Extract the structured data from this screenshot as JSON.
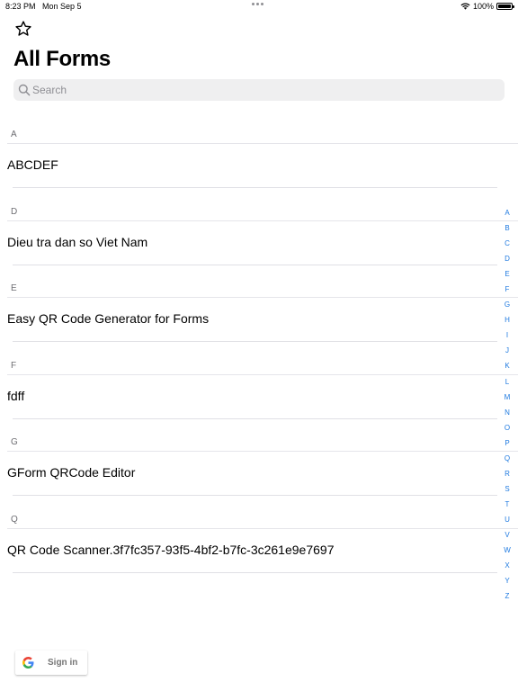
{
  "status_bar": {
    "time": "8:23 PM",
    "date": "Mon Sep 5",
    "battery": "100%",
    "battery_level": 1.0
  },
  "header": {
    "title": "All Forms",
    "favorite_icon": "star-outline-icon"
  },
  "search": {
    "placeholder": "Search",
    "value": "",
    "icon": "magnifying-glass-icon"
  },
  "sections": [
    {
      "letter": "A",
      "items": [
        "ABCDEF"
      ]
    },
    {
      "letter": "D",
      "items": [
        "Dieu tra dan so Viet Nam"
      ]
    },
    {
      "letter": "E",
      "items": [
        "Easy QR Code Generator for Forms"
      ]
    },
    {
      "letter": "F",
      "items": [
        "fdff"
      ]
    },
    {
      "letter": "G",
      "items": [
        "GForm QRCode Editor"
      ]
    },
    {
      "letter": "Q",
      "items": [
        "QR Code Scanner.3f7fc357-93f5-4bf2-b7fc-3c261e9e7697"
      ]
    }
  ],
  "index_bar": [
    "A",
    "B",
    "C",
    "D",
    "E",
    "F",
    "G",
    "H",
    "I",
    "J",
    "K",
    "L",
    "M",
    "N",
    "O",
    "P",
    "Q",
    "R",
    "S",
    "T",
    "U",
    "V",
    "W",
    "X",
    "Y",
    "Z"
  ],
  "signin": {
    "label": "Sign in",
    "icon": "google-g-icon"
  },
  "colors": {
    "accent": "#1f7ae0",
    "section_header": "#6d6d72",
    "search_background": "#efeff0",
    "separator": "#e5e5ea"
  }
}
